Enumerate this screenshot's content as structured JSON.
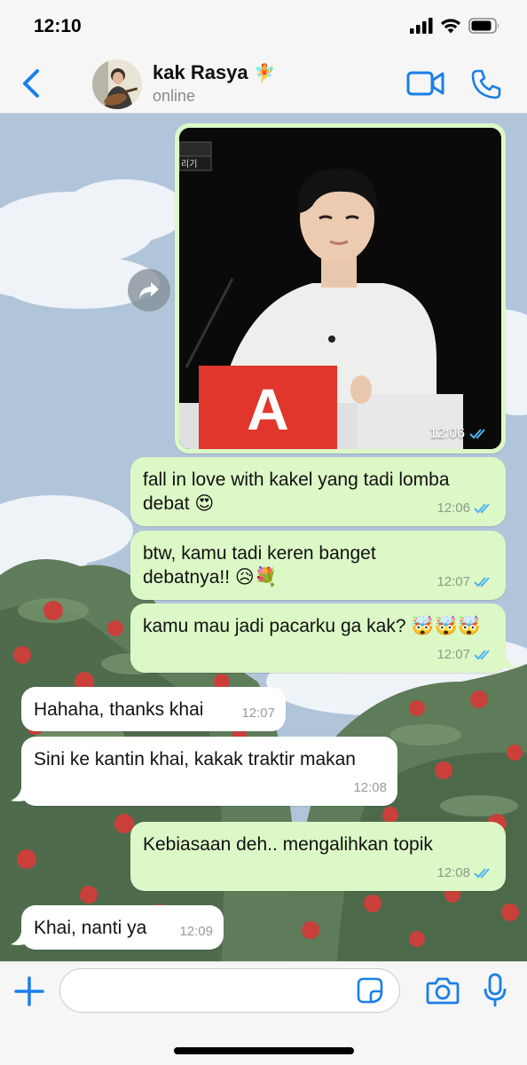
{
  "status_bar": {
    "time": "12:10"
  },
  "header": {
    "contact_name": "kak Rasya",
    "name_emoji": "🧚",
    "status": "online"
  },
  "messages": [
    {
      "id": "photo",
      "direction": "outgoing",
      "type": "image",
      "time": "12:06",
      "read": true,
      "image_caption_letter": "A",
      "image_tab_text": "리기"
    },
    {
      "id": "m1",
      "direction": "outgoing",
      "text": "fall in love with kakel yang tadi lomba debat 😍",
      "time": "12:06",
      "read": true
    },
    {
      "id": "m2",
      "direction": "outgoing",
      "text": "btw, kamu tadi keren banget debatnya!! 😥💐",
      "time": "12:07",
      "read": true
    },
    {
      "id": "m3",
      "direction": "outgoing",
      "text": "kamu mau jadi pacarku ga kak? 🤯🤯🤯",
      "time": "12:07",
      "read": true
    },
    {
      "id": "m4",
      "direction": "incoming",
      "text": "Hahaha, thanks khai",
      "time": "12:07"
    },
    {
      "id": "m5",
      "direction": "incoming",
      "text": "Sini ke kantin khai, kakak traktir makan",
      "time": "12:08"
    },
    {
      "id": "m6",
      "direction": "outgoing",
      "text": "Kebiasaan deh.. mengalihkan topik",
      "time": "12:08",
      "read": true
    },
    {
      "id": "m7",
      "direction": "incoming",
      "text": "Khai, nanti ya",
      "time": "12:09"
    }
  ],
  "input": {
    "placeholder": "",
    "value": ""
  },
  "colors": {
    "accent": "#1a7fe8",
    "outgoing_bubble": "#dcf8c6",
    "incoming_bubble": "#ffffff",
    "read_ticks": "#4fb3f2"
  },
  "icons": [
    "back-chevron-icon",
    "video-call-icon",
    "phone-icon",
    "forward-icon",
    "double-check-icon",
    "plus-icon",
    "sticker-icon",
    "camera-icon",
    "microphone-icon",
    "signal-icon",
    "wifi-icon",
    "battery-icon"
  ]
}
